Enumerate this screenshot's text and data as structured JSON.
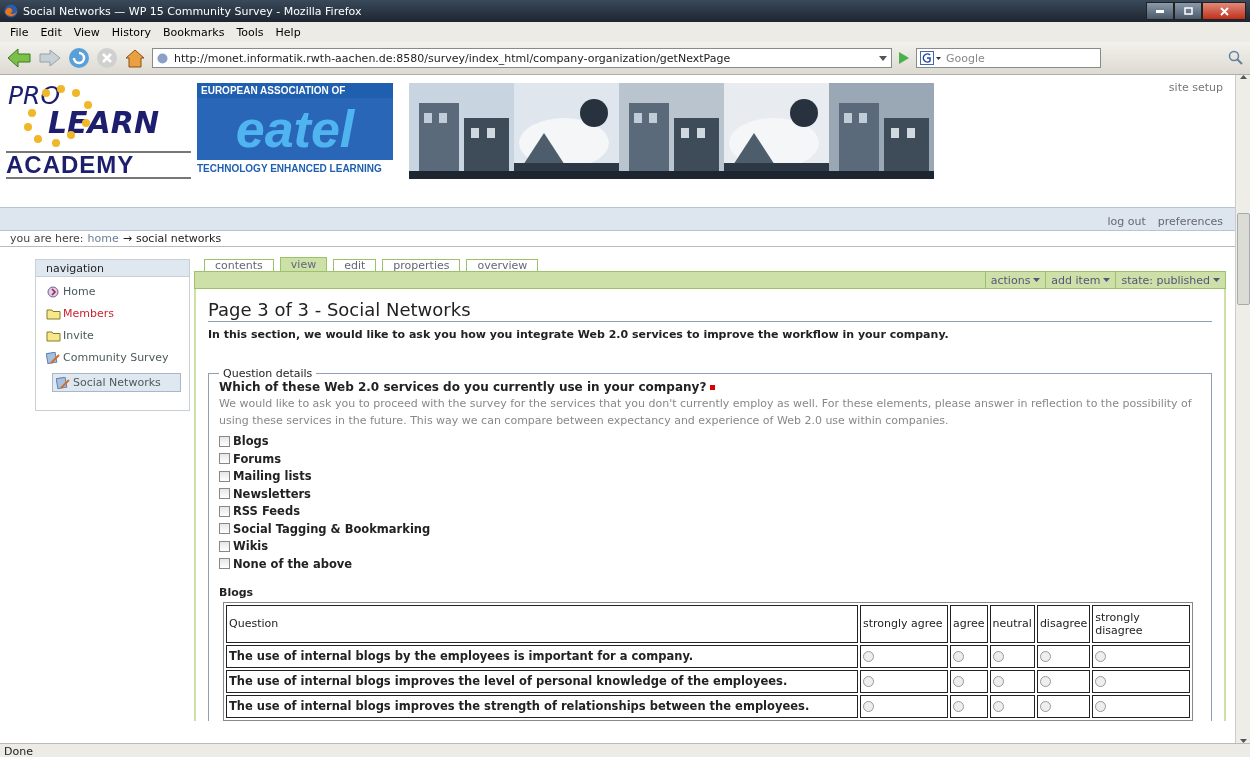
{
  "window": {
    "title": "Social Networks — WP 15 Community Survey - Mozilla Firefox"
  },
  "menu": [
    "File",
    "Edit",
    "View",
    "History",
    "Bookmarks",
    "Tools",
    "Help"
  ],
  "toolbar": {
    "url": "http://monet.informatik.rwth-aachen.de:8580/survey/index_html/company-organization/getNextPage",
    "search_placeholder": "Google"
  },
  "header": {
    "logo": {
      "line_1": "PRO",
      "line_2": "LEARN",
      "line_3": "ACADEMY"
    },
    "banner": {
      "top": "EUROPEAN ASSOCIATION OF",
      "name": "eatel",
      "bottom": "TECHNOLOGY ENHANCED LEARNING"
    },
    "site_setup": "site setup"
  },
  "user_links": [
    "log out",
    "preferences"
  ],
  "breadcrumb": {
    "label": "you are here:",
    "items": [
      "home",
      "social networks"
    ],
    "separator": "→"
  },
  "navigation": {
    "title": "navigation",
    "items": [
      {
        "label": "Home",
        "kind": "home",
        "color": "#4a5a5a",
        "selected": false
      },
      {
        "label": "Members",
        "kind": "folder",
        "color": "#cc2233",
        "selected": false
      },
      {
        "label": "Invite",
        "kind": "folder",
        "color": "#4a5a5a",
        "selected": false
      },
      {
        "label": "Community Survey",
        "kind": "survey",
        "color": "#4a5a5a",
        "selected": false,
        "children": [
          {
            "label": "Social Networks",
            "kind": "survey",
            "color": "#4a5a5a",
            "selected": true
          }
        ]
      }
    ]
  },
  "tabs": [
    {
      "label": "contents",
      "selected": false
    },
    {
      "label": "view",
      "selected": true
    },
    {
      "label": "edit",
      "selected": false
    },
    {
      "label": "properties",
      "selected": false
    },
    {
      "label": "overview",
      "selected": false
    }
  ],
  "actions": [
    "actions",
    "add item",
    "state: published"
  ],
  "page": {
    "heading": "Page 3 of 3 - Social Networks",
    "intro": "In this section, we would like to ask you how you integrate Web 2.0 services to improve the workflow in your company.",
    "legend": "Question details",
    "question": "Which of these Web 2.0 services do you currently use in your company?",
    "required": true,
    "help": "We would like to ask you to proceed with the survey for the services that you don't currently employ as well. For these elements, please answer in reflection to the possibility of using these services in the future. This way we can compare between expectancy and experience of Web 2.0 use within companies.",
    "options": [
      {
        "label": "Blogs",
        "checked": false
      },
      {
        "label": "Forums",
        "checked": false
      },
      {
        "label": "Mailing lists",
        "checked": false
      },
      {
        "label": "Newsletters",
        "checked": false
      },
      {
        "label": "RSS Feeds",
        "checked": false
      },
      {
        "label": "Social Tagging & Bookmarking",
        "checked": false
      },
      {
        "label": "Wikis",
        "checked": false
      },
      {
        "label": "None of the above",
        "checked": false
      }
    ],
    "section": "Blogs",
    "columns": [
      "Question",
      "strongly agree",
      "agree",
      "neutral",
      "disagree",
      "strongly disagree"
    ],
    "rows": [
      {
        "question": "The use of internal blogs by the employees is important for a company.",
        "answers": [
          {
            "selected": false
          },
          {
            "selected": false
          },
          {
            "selected": false
          },
          {
            "selected": false
          },
          {
            "selected": false
          }
        ]
      },
      {
        "question": "The use of internal blogs improves the level of personal knowledge of the employees.",
        "answers": [
          {
            "selected": false
          },
          {
            "selected": false
          },
          {
            "selected": false
          },
          {
            "selected": false
          },
          {
            "selected": false
          }
        ]
      },
      {
        "question": "The use of internal blogs improves the strength of relationships between the employees.",
        "answers": [
          {
            "selected": false
          },
          {
            "selected": false
          },
          {
            "selected": false
          },
          {
            "selected": false
          },
          {
            "selected": false
          }
        ]
      }
    ]
  },
  "status": "Done"
}
